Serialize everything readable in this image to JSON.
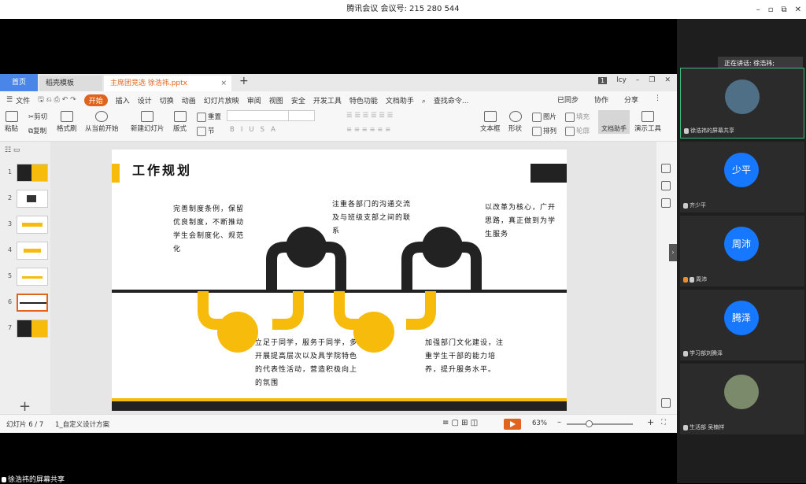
{
  "meeting": {
    "title": "腾讯会议 会议号: 215 280 544"
  },
  "window_controls": [
    "–",
    "▫",
    "⧉",
    "✕"
  ],
  "wps": {
    "tabs": {
      "home": "首页",
      "template": "稻壳模板",
      "document": "主席团竞选 徐浩祎.pptx",
      "close": "×",
      "add": "+"
    },
    "tab_right": {
      "badge": "1",
      "user": "lcy"
    },
    "menu": [
      "文件",
      "开始",
      "插入",
      "设计",
      "切换",
      "动画",
      "幻灯片放映",
      "审阅",
      "视图",
      "安全",
      "开发工具",
      "特色功能",
      "文档助手",
      "查找命令..."
    ],
    "menu_right": [
      "已同步",
      "协作",
      "分享"
    ],
    "toolbar": {
      "paste": "粘贴",
      "cut": "剪切",
      "copy": "复制",
      "format_painter": "格式刷",
      "from_current": "从当前开始",
      "new_slide": "新建幻灯片",
      "layout": "版式",
      "reset": "重置",
      "section": "节",
      "textbox": "文本框",
      "shape": "形状",
      "picture": "图片",
      "arrange": "排列",
      "fill": "填充",
      "outline": "轮廓",
      "doc_helper": "文档助手",
      "present_tool": "演示工具",
      "format_buttons": [
        "B",
        "I",
        "U",
        "S",
        "A"
      ]
    },
    "thumbnails": [
      "1",
      "2",
      "3",
      "4",
      "5",
      "6",
      "7"
    ],
    "active_slide": "6",
    "status": {
      "slide_count": "幻灯片 6 / 7",
      "theme": "1_自定义设计方案",
      "zoom": "63%"
    }
  },
  "slide": {
    "title": "工作规划",
    "items": [
      "完善制度条例，保留优良制度，不断推动学生会制度化、规范化",
      "注重各部门的沟通交流及与班级支部之间的联系",
      "以改革为核心，广开思路，真正做到为学生服务",
      "立足于同学，服务于同学，多开展提高层次以及具学院特色的代表性活动，营造积极向上的氛围",
      "加强部门文化建设，注重学生干部的能力培养，提升服务水平。"
    ],
    "colors": {
      "yellow": "#f6bb0b",
      "dark": "#222222"
    }
  },
  "participants": {
    "speaking": "正在讲话: 徐浩祎;",
    "tiles": [
      {
        "name": "徐浩祎的屏幕共享",
        "type": "image"
      },
      {
        "name": "齐少平",
        "avatar_text": "少平",
        "type": "circle"
      },
      {
        "name": "周沛",
        "avatar_text": "周沛",
        "type": "circle"
      },
      {
        "name": "学习部刘腾泽",
        "avatar_text": "腾泽",
        "type": "circle"
      },
      {
        "name": "生活部 吴楠祥",
        "type": "image"
      }
    ]
  },
  "bottom_bar": {
    "share_label": "徐浩祎的屏幕共享"
  }
}
